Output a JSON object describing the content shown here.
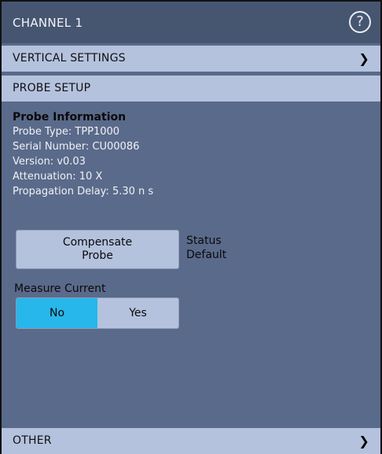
{
  "header": {
    "title": "CHANNEL 1",
    "help_icon": "help-circle-icon",
    "help_glyph": "?"
  },
  "sections": {
    "vertical_settings": "VERTICAL SETTINGS",
    "probe_setup": "PROBE SETUP",
    "other": "OTHER",
    "chevron_glyph": "❯"
  },
  "probe_info": {
    "title": "Probe Information",
    "lines": [
      "Probe Type: TPP1000",
      "Serial Number: CU00086",
      "Version: v0.03",
      "Attenuation: 10 X",
      "Propagation Delay: 5.30 n s"
    ]
  },
  "compensate": {
    "line1": "Compensate",
    "line2": "Probe",
    "status_label": "Status",
    "status_value": "Default"
  },
  "measure_current": {
    "label": "Measure Current",
    "options": [
      "No",
      "Yes"
    ],
    "selected": "No"
  },
  "colors": {
    "panel_bg": "#5a6a8a",
    "title_bg": "#465671",
    "section_bg": "#b4c2de",
    "accent": "#27b7ea"
  }
}
